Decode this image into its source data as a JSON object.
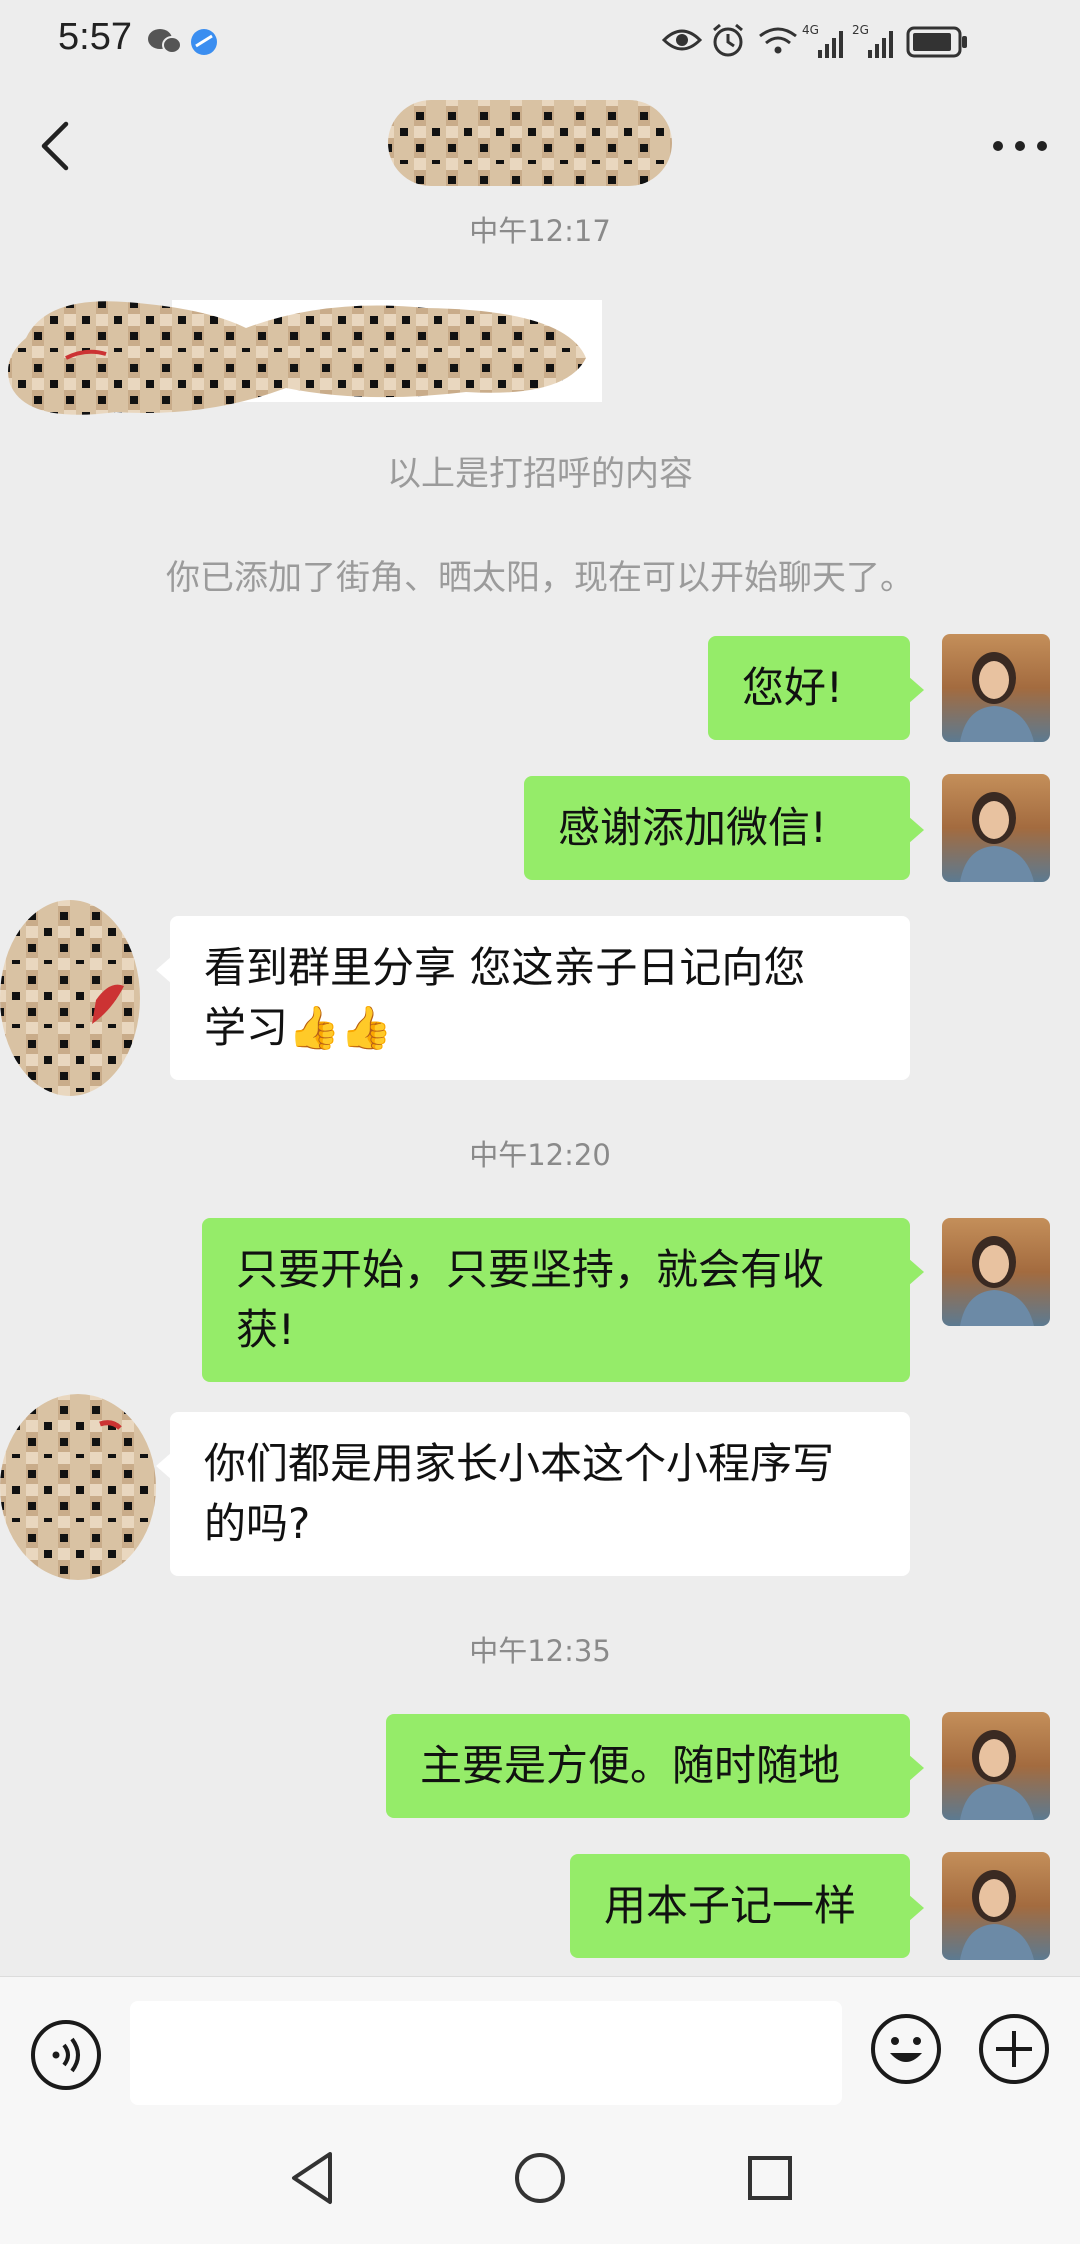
{
  "status_bar": {
    "time": "5:57",
    "icons": [
      "wechat-icon",
      "browser-icon",
      "eye-icon",
      "alarm-icon",
      "wifi-icon",
      "4g-signal-icon",
      "2g-signal-icon",
      "battery-icon"
    ],
    "signal_labels": [
      "4G",
      "2G"
    ]
  },
  "header": {
    "back_icon": "chevron-left-icon",
    "more_icon": "more-dots-icon"
  },
  "chat": {
    "time_1": "中午12:17",
    "greeting_note": "以上是打招呼的内容",
    "added_note": "你已添加了街角、晒太阳，现在可以开始聊天了。",
    "msg_1": "您好!",
    "msg_2": "感谢添加微信!",
    "msg_3_line1": "看到群里分享 您这亲子日记向您",
    "msg_3_line2": "学习👍👍",
    "time_2": "中午12:20",
    "msg_4_line1": "只要开始，只要坚持，就会有收",
    "msg_4_line2": "获!",
    "msg_5_line1": "你们都是用家长小本这个小程序写",
    "msg_5_line2": "的吗?",
    "time_3": "中午12:35",
    "msg_6": "主要是方便。随时随地",
    "msg_7": "用本子记一样"
  },
  "input_bar": {
    "value": "",
    "icons": [
      "voice-icon",
      "emoji-icon",
      "plus-icon"
    ]
  },
  "colors": {
    "background": "#ededed",
    "my_bubble": "#95ec69",
    "other_bubble": "#ffffff",
    "timestamp": "#8a8a8a"
  }
}
